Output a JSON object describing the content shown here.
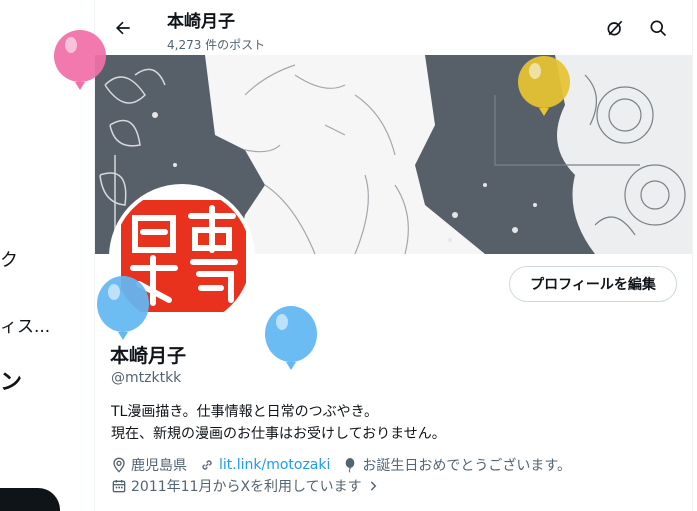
{
  "sidebar": {
    "fragments": [
      "ク",
      "ィス...",
      "ン"
    ]
  },
  "header": {
    "name": "本崎月子",
    "post_count": "4,273 件のポスト"
  },
  "profile": {
    "name": "本崎月子",
    "handle": "@mtzktkk",
    "edit_button": "プロフィールを編集",
    "bio": [
      "TL漫画描き。仕事情報と日常のつぶやき。",
      "現在、新規の漫画のお仕事はお受けしておりません。"
    ],
    "location": "鹿児島県",
    "link": "lit.link/motozaki",
    "birthday_message": "お誕生日おめでとうございます。",
    "joined": "2011年11月からXを利用しています"
  },
  "avatar_seal_text": "本崎",
  "colors": {
    "accent": "#1d9bf0",
    "seal": "#e8321e",
    "balloon_pink": "#f06fa8",
    "balloon_yellow": "#e6c432",
    "balloon_blue": "#62b8f2"
  }
}
